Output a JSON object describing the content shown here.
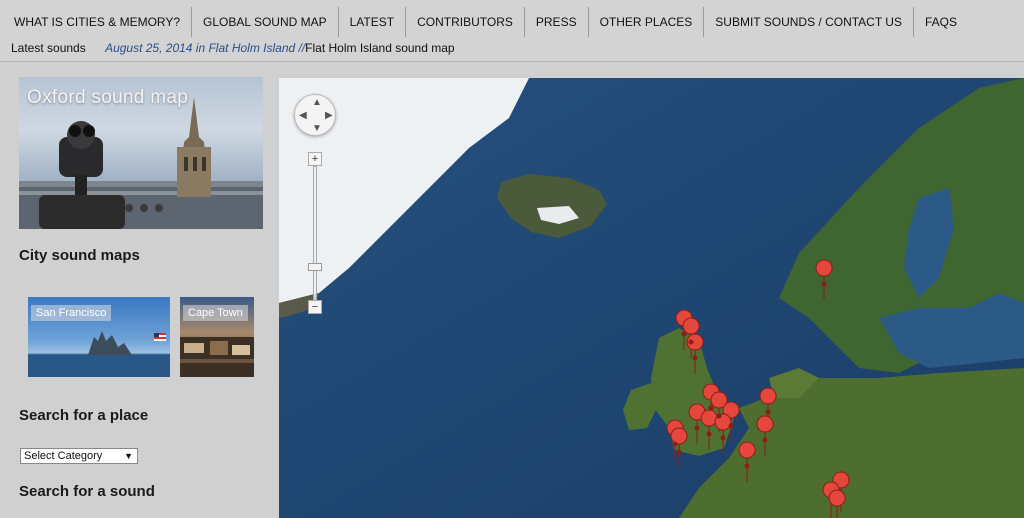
{
  "nav": {
    "items": [
      "WHAT IS CITIES & MEMORY?",
      "GLOBAL SOUND MAP",
      "LATEST",
      "CONTRIBUTORS",
      "PRESS",
      "OTHER PLACES",
      "SUBMIT SOUNDS / CONTACT US",
      "FAQS"
    ]
  },
  "ticker": {
    "label": "Latest sounds",
    "date": "August 25, 2014 in Flat Holm Island //",
    "title": "Flat Holm Island sound map"
  },
  "sidebar": {
    "hero_title": "Oxford sound map",
    "city_maps_heading": "City sound maps",
    "thumbs": [
      "San Francisco",
      "Cape Town"
    ],
    "search_place_heading": "Search for a place",
    "select_value": "Select Category",
    "search_sound_heading": "Search for a sound"
  },
  "map": {
    "controls": {
      "zoom_in": "+",
      "zoom_out": "−"
    },
    "marker_color": "#e5473c",
    "land_color": "#4a6b2e",
    "sea_color": "#1f4675",
    "ice_color": "#f2f4f6"
  }
}
